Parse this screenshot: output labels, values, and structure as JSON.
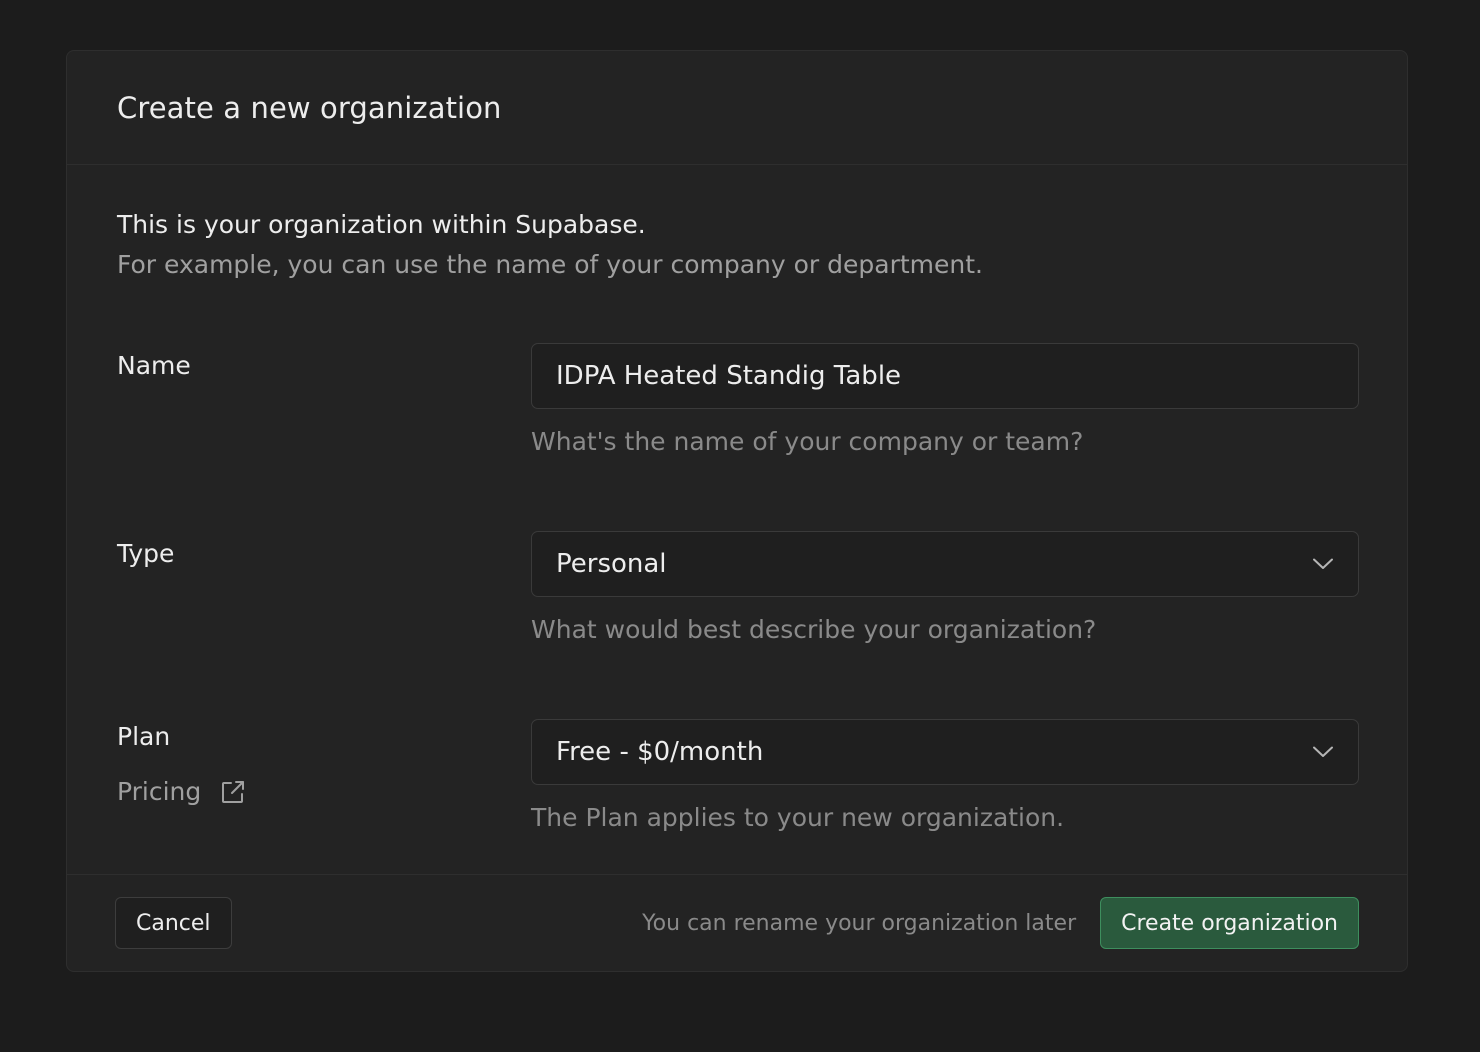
{
  "dialog": {
    "title": "Create a new organization",
    "intro_line1": "This is your organization within Supabase.",
    "intro_line2": "For example, you can use the name of your company or department."
  },
  "fields": {
    "name": {
      "label": "Name",
      "value": "IDPA Heated Standig Table",
      "help": "What's the name of your company or team?"
    },
    "type": {
      "label": "Type",
      "value": "Personal",
      "help": "What would best describe your organization?"
    },
    "plan": {
      "label": "Plan",
      "value": "Free - $0/month",
      "help": "The Plan applies to your new organization.",
      "pricing_link": "Pricing"
    }
  },
  "footer": {
    "cancel_label": "Cancel",
    "note": "You can rename your organization later",
    "create_label": "Create organization"
  },
  "icons": {
    "chevron": "chevron-down-icon",
    "external": "external-link-icon"
  },
  "colors": {
    "background": "#1c1c1c",
    "panel": "#232323",
    "brand_button": "#2a5a3d",
    "brand_border": "#3e8e5e"
  }
}
